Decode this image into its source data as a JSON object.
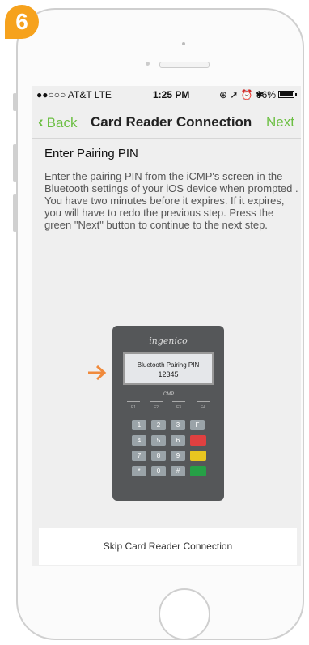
{
  "step_badge": "6",
  "status_bar": {
    "carrier": "●●○○○ AT&T  LTE",
    "time": "1:25 PM",
    "icons": "⊕ ➚ ⏰ ✱",
    "battery": "96%"
  },
  "nav": {
    "back_label": "Back",
    "title": "Card Reader Connection",
    "next_label": "Next"
  },
  "content": {
    "heading": "Enter Pairing PIN",
    "body": "Enter the pairing PIN from the iCMP's screen in the Bluetooth settings of your iOS device when prompted . You have two minutes before it expires. If it expires, you will have to redo the previous step. Press the green \"Next\" button to continue to the next step."
  },
  "device": {
    "brand": "ingenico",
    "screen_line1": "Bluetooth Pairing PIN",
    "screen_line2": "12345",
    "model": "iCMP",
    "fkeys": [
      "F1",
      "F2",
      "F3",
      "F4"
    ],
    "keys": [
      "1",
      "2",
      "3",
      "F",
      "4",
      "5",
      "6",
      "",
      "7",
      "8",
      "9",
      "",
      "*",
      "0",
      "#",
      ""
    ]
  },
  "skip_button_label": "Skip Card Reader Connection",
  "colors": {
    "accent_green": "#6cbf43",
    "badge_orange": "#f6a21d",
    "arrow_orange": "#f08a3c"
  }
}
